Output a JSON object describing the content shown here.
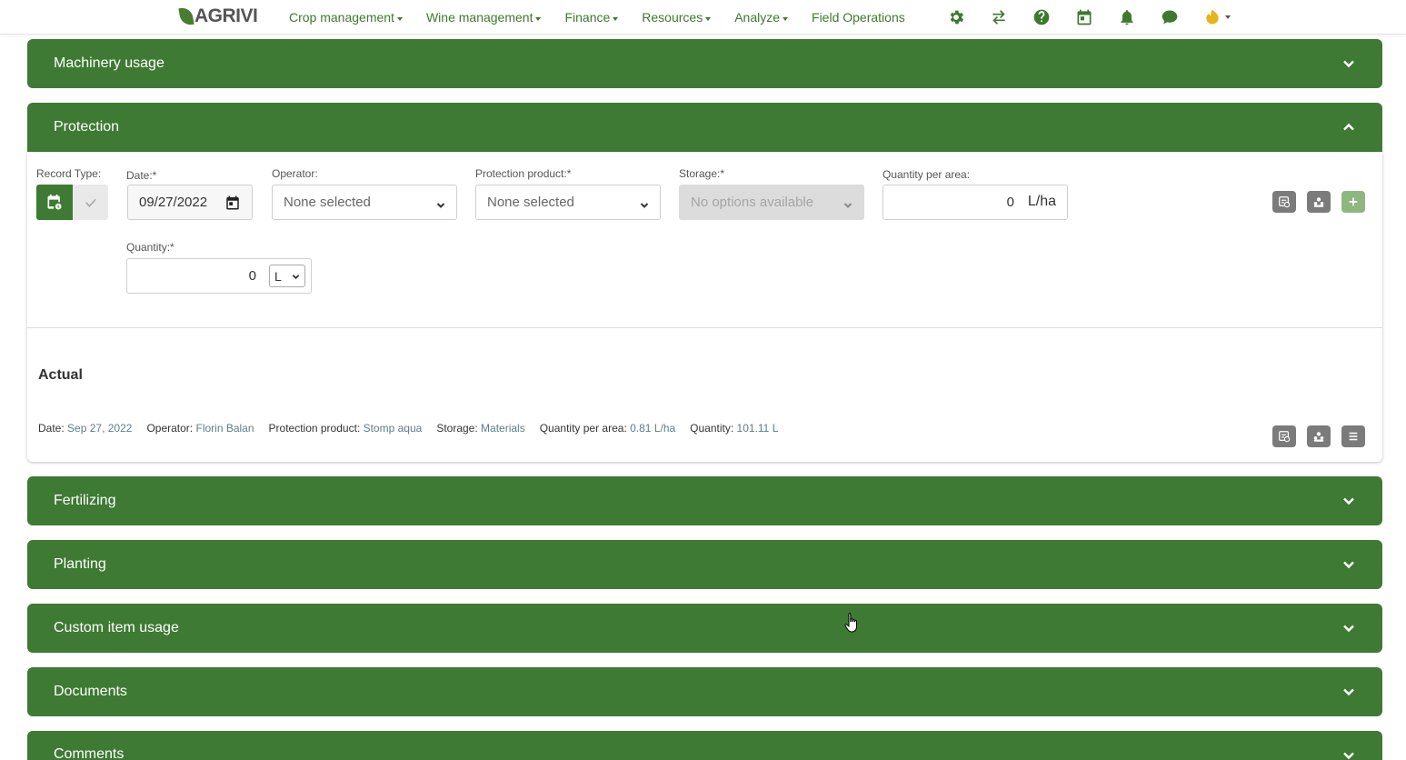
{
  "header": {
    "logo_text": "AGRIVI",
    "menu": [
      {
        "label": "Crop management"
      },
      {
        "label": "Wine management"
      },
      {
        "label": "Finance"
      },
      {
        "label": "Resources"
      },
      {
        "label": "Analyze"
      },
      {
        "label": "Field Operations"
      }
    ],
    "icons": [
      "gear-icon",
      "swap-icon",
      "help-icon",
      "calendar-icon",
      "bell-icon",
      "chat-icon",
      "user-icon"
    ]
  },
  "sections": {
    "machinery": "Machinery usage",
    "protection": "Protection",
    "fertilizing": "Fertilizing",
    "planting": "Planting",
    "custom": "Custom item usage",
    "documents": "Documents",
    "comments": "Comments"
  },
  "protection_form": {
    "record_type_label": "Record Type:",
    "date_label": "Date:*",
    "date_value": "09/27/2022",
    "operator_label": "Operator:",
    "operator_value": "None selected",
    "product_label": "Protection product:*",
    "product_value": "None selected",
    "storage_label": "Storage:*",
    "storage_value": "No options available",
    "qpa_label": "Quantity per area:",
    "qpa_value": "0",
    "qpa_unit": "L/ha",
    "quantity_label": "Quantity:*",
    "quantity_value": "0",
    "quantity_unit": "L"
  },
  "actual": {
    "title": "Actual",
    "date_label": "Date:",
    "date_value": "Sep 27, 2022",
    "operator_label": "Operator:",
    "operator_value": "Florin Balan",
    "product_label": "Protection product:",
    "product_value": "Stomp aqua",
    "storage_label": "Storage:",
    "storage_value": "Materials",
    "qpa_label": "Quantity per area:",
    "qpa_value": "0.81 L/ha",
    "quantity_label": "Quantity:",
    "quantity_value": "101.11 L"
  },
  "colors": {
    "brand_green": "#3e7a33",
    "link_green": "#3e7a2d",
    "value_blue": "#5c7d8c",
    "user_icon_yellow": "#e8b21a"
  }
}
